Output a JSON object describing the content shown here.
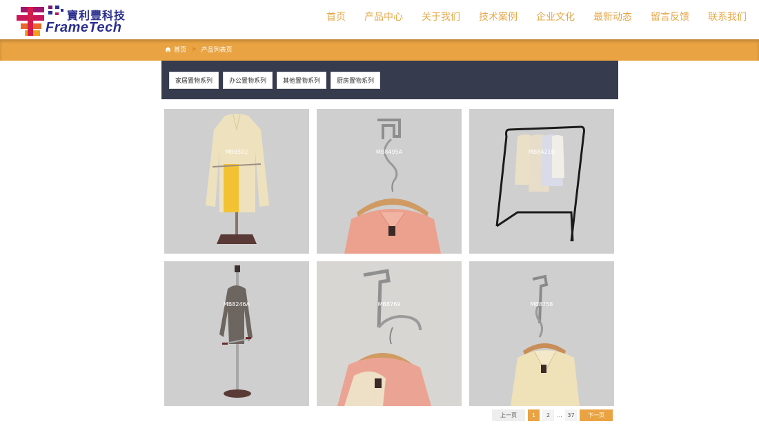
{
  "brand": {
    "name_cn": "寶利豐科技",
    "name_en": "FrameTech"
  },
  "nav": {
    "items": [
      {
        "label": "首页"
      },
      {
        "label": "产品中心"
      },
      {
        "label": "关于我们"
      },
      {
        "label": "技术案例"
      },
      {
        "label": "企业文化"
      },
      {
        "label": "最新动态"
      },
      {
        "label": "留言反馈"
      },
      {
        "label": "联系我们"
      }
    ]
  },
  "breadcrumb": {
    "home": "首页",
    "separator": ">",
    "current": "产品列表页",
    "icon": "home-icon"
  },
  "categories": [
    {
      "label": "家居置物系列"
    },
    {
      "label": "办公置物系列"
    },
    {
      "label": "其他置物系列"
    },
    {
      "label": "厨房置物系列"
    }
  ],
  "products": [
    {
      "code": "MB8502"
    },
    {
      "code": "MB8495A"
    },
    {
      "code": "MB8421B"
    },
    {
      "code": "MB8246A"
    },
    {
      "code": "MB8769"
    },
    {
      "code": "MB8758"
    }
  ],
  "pagination": {
    "prev": "上一页",
    "pages": [
      "1",
      "2"
    ],
    "ellipsis": "...",
    "last": "37",
    "next": "下一页",
    "current": "1"
  },
  "colors": {
    "accent": "#e9a342",
    "nav_text": "#e7a84a",
    "filter_band": "#373b4e",
    "card_bg": "#cfcfcf",
    "logo_blue": "#2a2f8e"
  }
}
